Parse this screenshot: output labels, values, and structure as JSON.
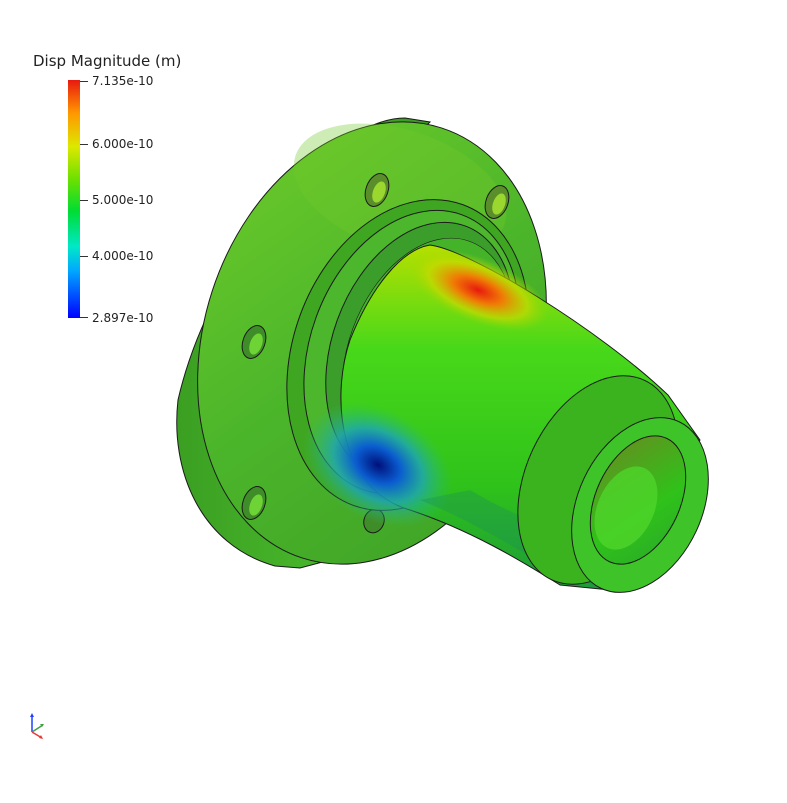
{
  "legend": {
    "title": "Disp Magnitude (m)",
    "max_label": "7.135e-10",
    "tick_6": "6.000e-10",
    "tick_5": "5.000e-10",
    "tick_4": "4.000e-10",
    "min_label": "2.897e-10",
    "colormap": [
      "#0000ff",
      "#00a9ff",
      "#00e8c8",
      "#00dd33",
      "#6ae000",
      "#dde800",
      "#ff9800",
      "#e8190f"
    ]
  },
  "colors": {
    "flange_face": "#52c42a",
    "flange_rim": "#3aa31e",
    "shaft": "#3ed40c",
    "hotspot": "#e8190f",
    "coldspot": "#00107a",
    "edge": "#1b1b1b",
    "background": "#ffffff"
  },
  "axes": {
    "labels": [
      "x",
      "y",
      "z"
    ],
    "colors": [
      "#e53935",
      "#43a047",
      "#1e40ff"
    ]
  }
}
